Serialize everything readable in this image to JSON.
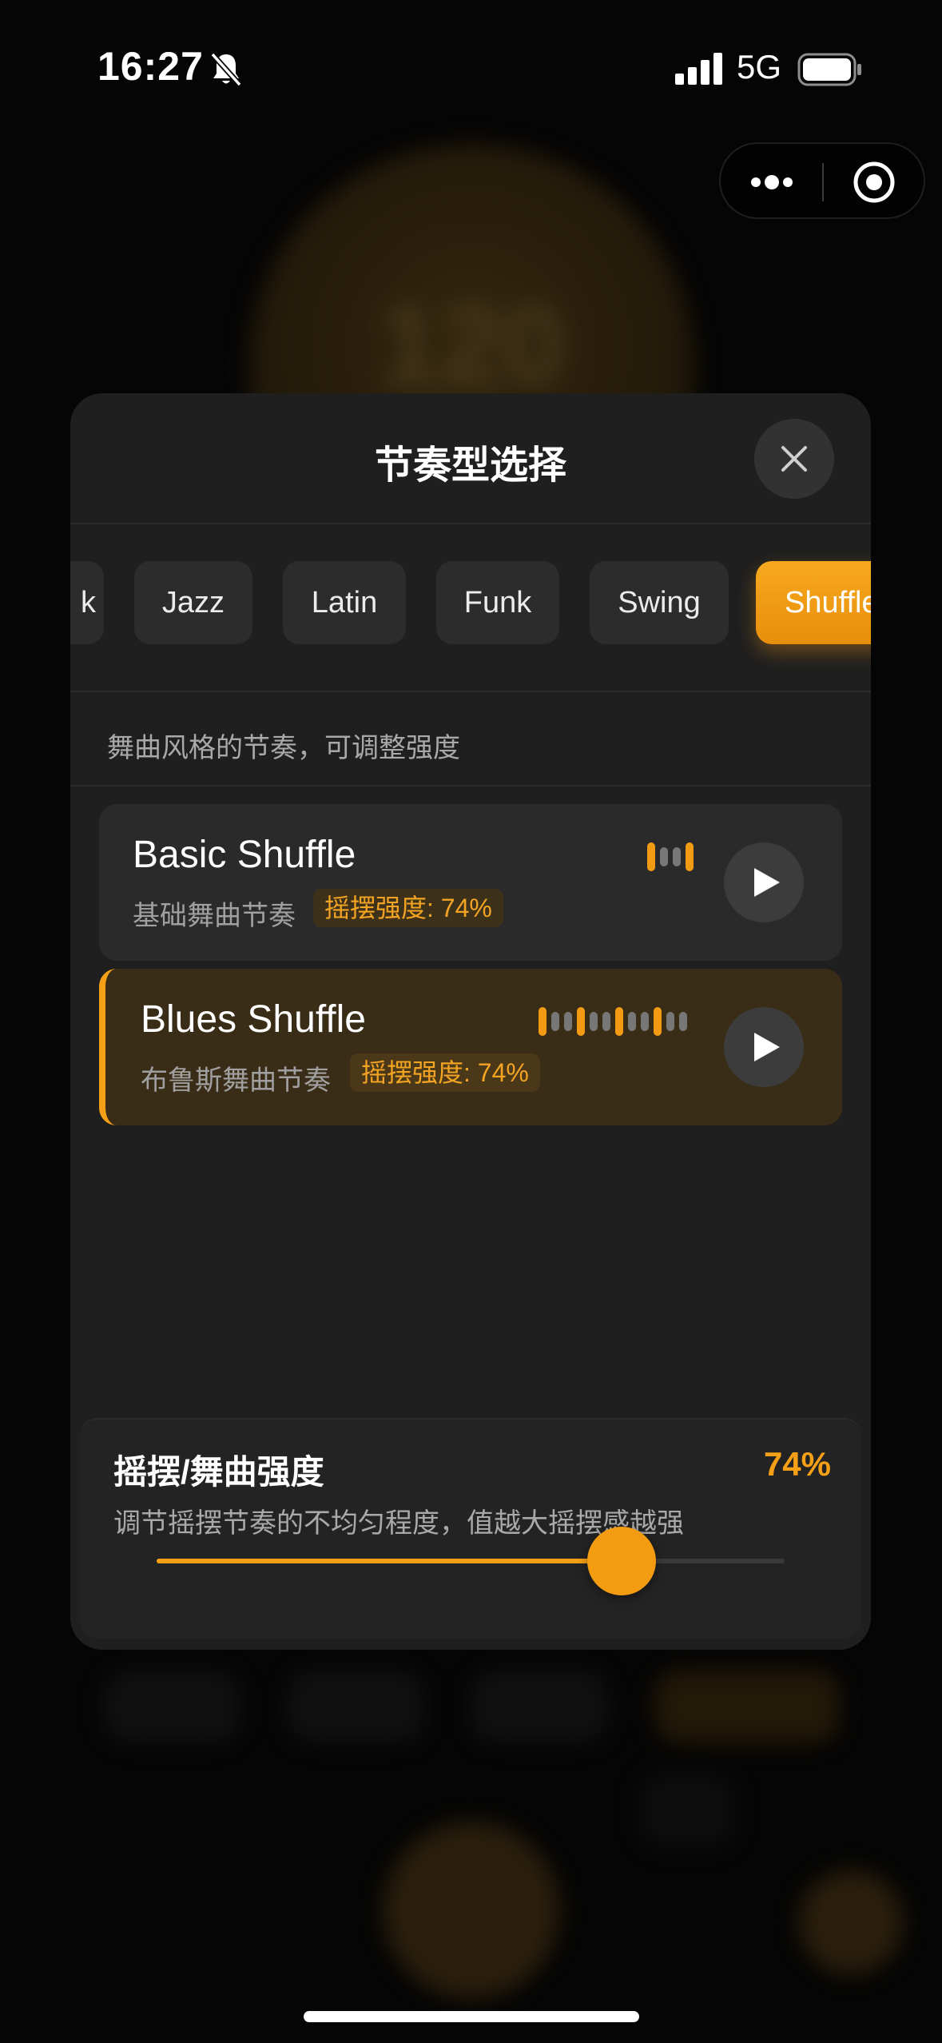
{
  "status_bar": {
    "time": "16:27",
    "network": "5G",
    "silent_icon": "bell-slash-icon",
    "signal_icon": "cellular-signal-icon",
    "battery_icon": "battery-full-icon"
  },
  "capsule": {
    "more_icon": "more-dots-icon",
    "close_icon": "target-circle-icon"
  },
  "background": {
    "tempo": "120"
  },
  "sheet": {
    "title": "节奏型选择",
    "close_icon": "close-icon",
    "tabs": [
      {
        "label": "k"
      },
      {
        "label": "Jazz"
      },
      {
        "label": "Latin"
      },
      {
        "label": "Funk"
      },
      {
        "label": "Swing"
      },
      {
        "label": "Shuffle",
        "active": true
      }
    ],
    "hint": "舞曲风格的节奏，可调整强度",
    "rhythms": [
      {
        "name": "Basic Shuffle",
        "description": "基础舞曲节奏",
        "tag": "摇摆强度: 74%",
        "pattern": [
          1,
          0,
          0,
          1
        ],
        "selected": false
      },
      {
        "name": "Blues Shuffle",
        "description": "布鲁斯舞曲节奏",
        "tag": "摇摆强度: 74%",
        "pattern": [
          1,
          0,
          0,
          1,
          0,
          0,
          1,
          0,
          0,
          1,
          0,
          0
        ],
        "selected": true
      }
    ],
    "swing": {
      "title": "摇摆/舞曲强度",
      "value": "74%",
      "description": "调节摇摆节奏的不均匀程度，值越大摇摆感越强",
      "level": 0.74
    }
  },
  "colors": {
    "accent": "#f5a016",
    "sheet_bg": "#1f1f1f",
    "card_bg": "#2a2a2a",
    "selected_card_bg": "#3a2d18"
  }
}
